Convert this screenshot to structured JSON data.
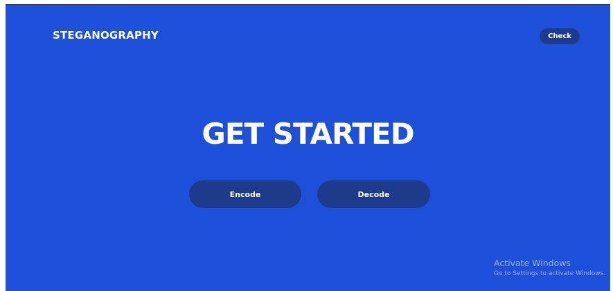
{
  "header": {
    "brand": "STEGANOGRAPHY",
    "check_label": "Check"
  },
  "hero": {
    "title": "GET STARTED",
    "encode_label": "Encode",
    "decode_label": "Decode"
  },
  "watermark": {
    "title": "Activate Windows",
    "subtitle": "Go to Settings to activate Windows."
  },
  "colors": {
    "background": "#1e4fd8",
    "button": "#1e3a8a",
    "text": "#ffffff"
  }
}
